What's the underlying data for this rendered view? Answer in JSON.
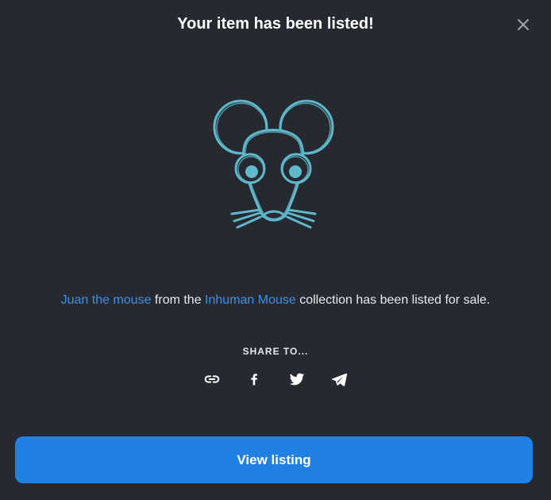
{
  "modal": {
    "title": "Your item has been listed!",
    "close_icon": "close-icon"
  },
  "artwork": {
    "icon": "mouse-face-icon",
    "color": "#5fb8cc"
  },
  "message": {
    "item_name": "Juan the mouse",
    "from_text": " from the ",
    "collection_name": "Inhuman Mouse",
    "suffix_text": " collection has been listed for sale."
  },
  "share": {
    "label": "SHARE TO...",
    "icons": [
      "link-icon",
      "facebook-icon",
      "twitter-icon",
      "telegram-icon"
    ]
  },
  "actions": {
    "view_listing_label": "View listing",
    "accent_color": "#2081e2"
  },
  "colors": {
    "background": "#262a30",
    "link": "#3f8fe8"
  }
}
